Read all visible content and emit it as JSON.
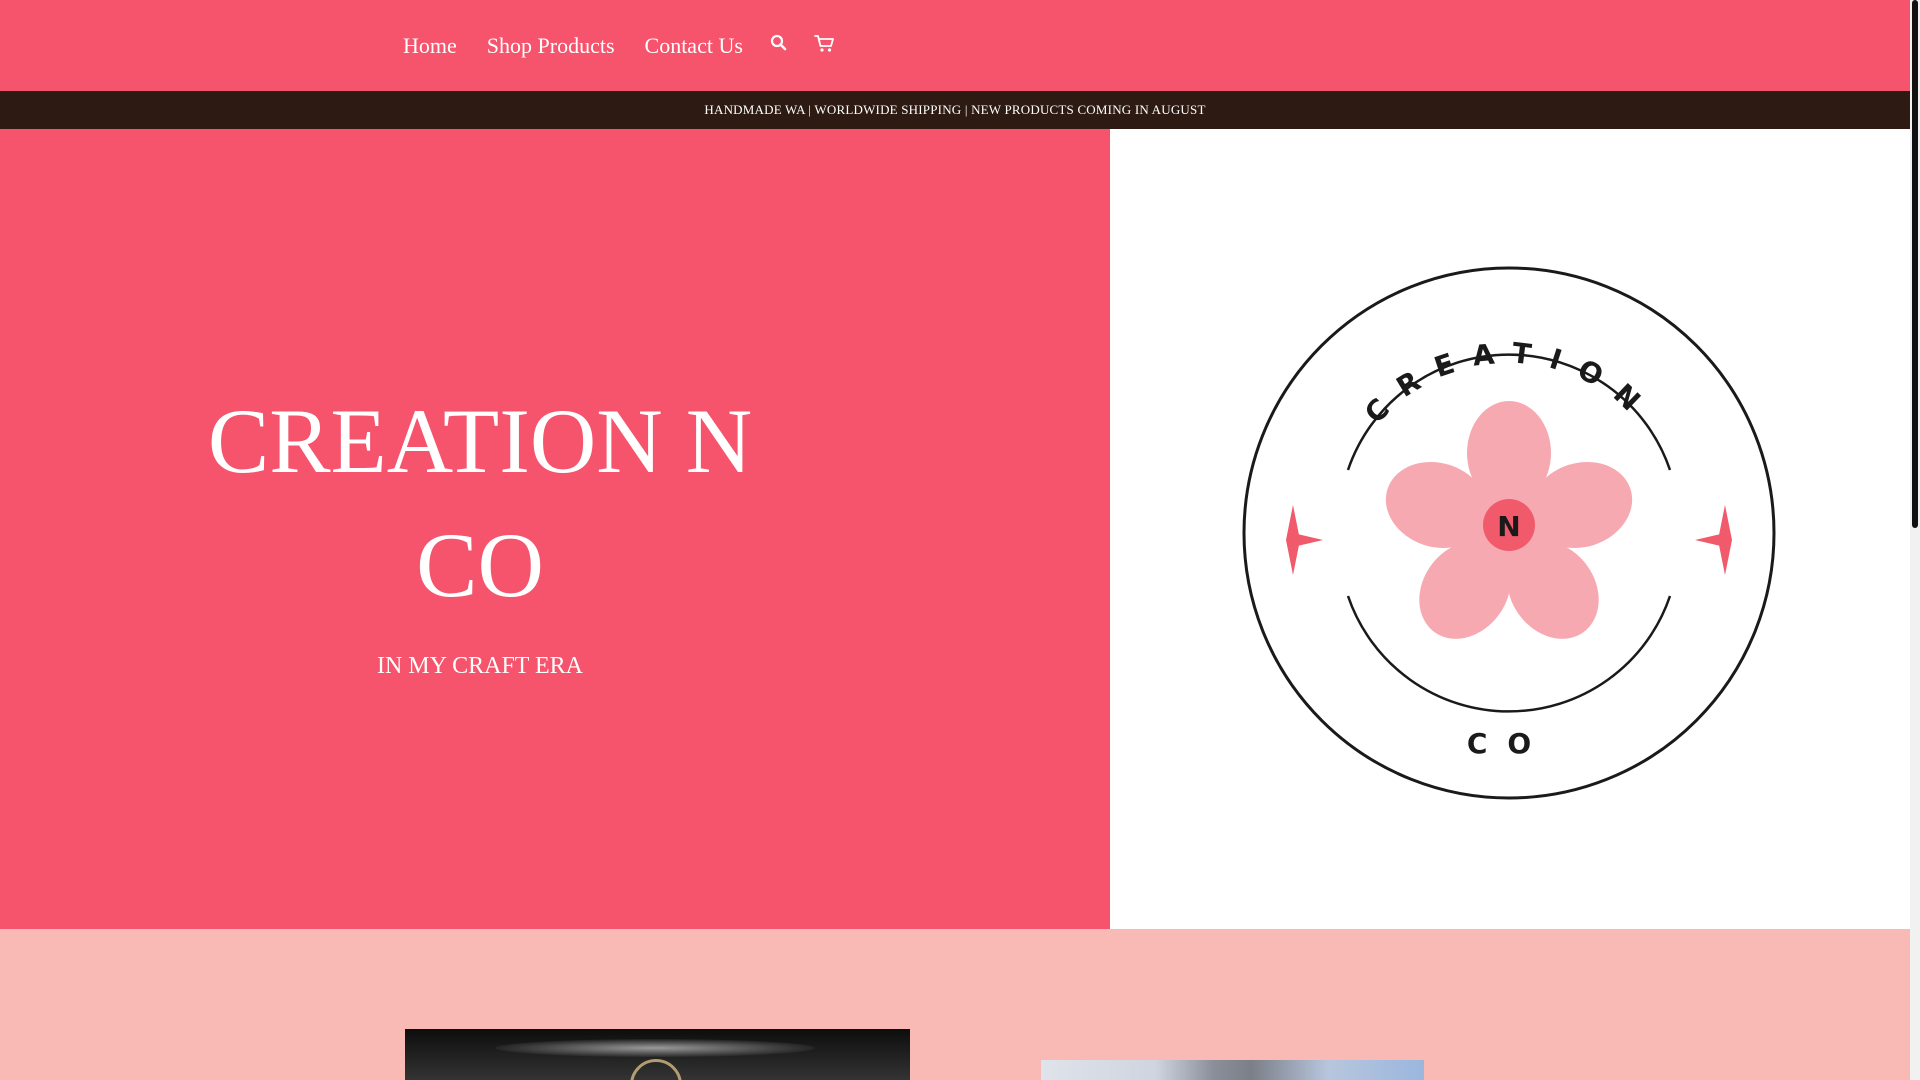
{
  "nav": {
    "items": [
      {
        "label": "Home"
      },
      {
        "label": "Shop Products"
      },
      {
        "label": "Contact Us"
      }
    ],
    "icons": [
      "search-icon",
      "cart-icon"
    ]
  },
  "announcement": "HANDMADE WA | WORLDWIDE SHIPPING | NEW PRODUCTS COMING IN AUGUST",
  "hero": {
    "title": "CREATION N CO",
    "subtitle": "IN MY CRAFT ERA"
  },
  "logo": {
    "top_text": "CREATION",
    "center_letter": "N",
    "bottom_text": "CO"
  },
  "colors": {
    "brand": "#f5546c",
    "announcement_bg": "#2d1a12",
    "section_bg": "#f9b9b5",
    "flower": "#f7a9b1",
    "flower_center": "#f05a6b"
  }
}
